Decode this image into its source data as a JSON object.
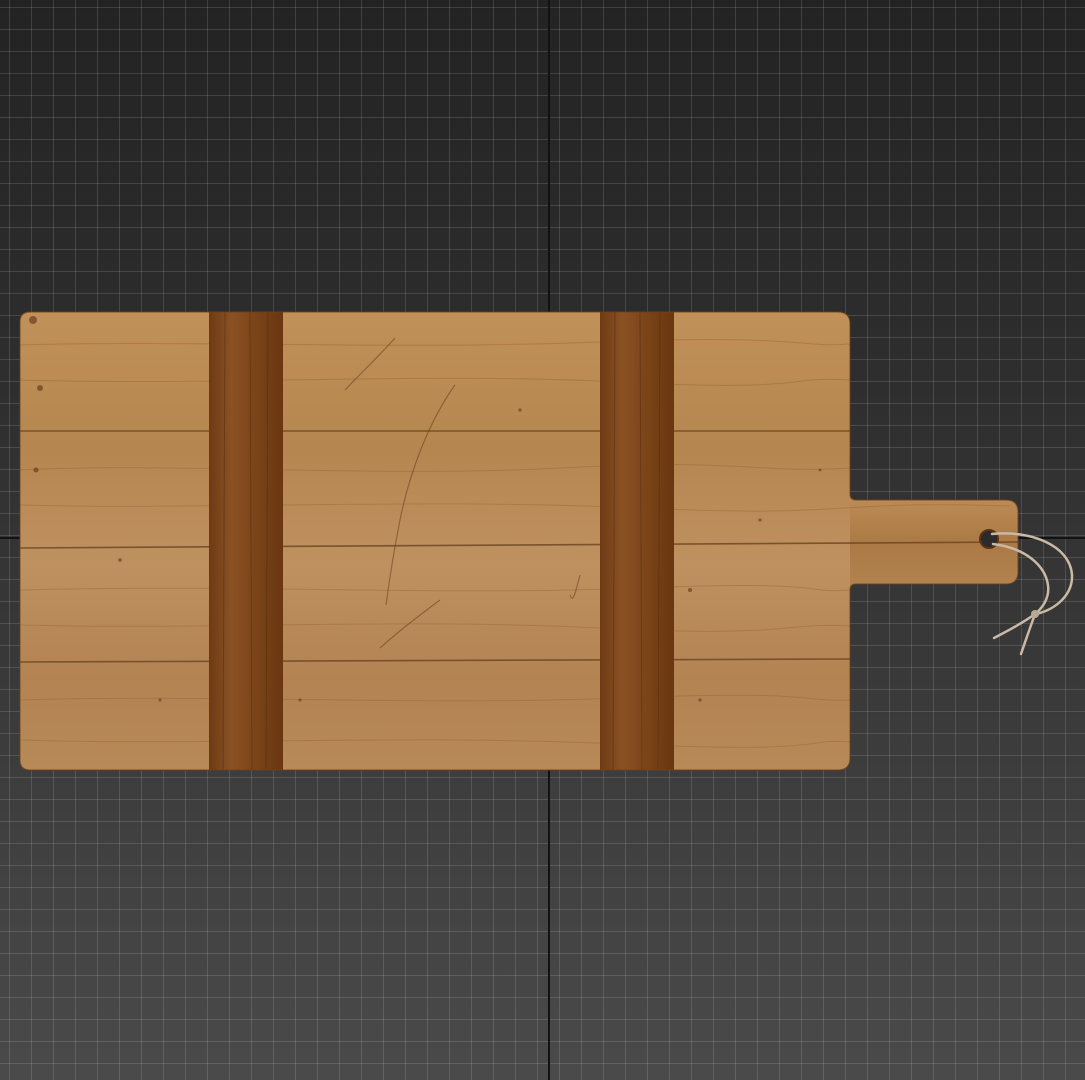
{
  "viewport": {
    "background_top": "#232323",
    "background_bottom": "#4a4a4a",
    "grid_color": "#5a5a5a",
    "axis_color": "#121212"
  },
  "object": {
    "name": "cutting-board",
    "wood_color": "#b98a55",
    "wood_dark_color": "#8d5a2b",
    "cleat_color": "#7a4218",
    "string_color": "#c9b9a6"
  }
}
